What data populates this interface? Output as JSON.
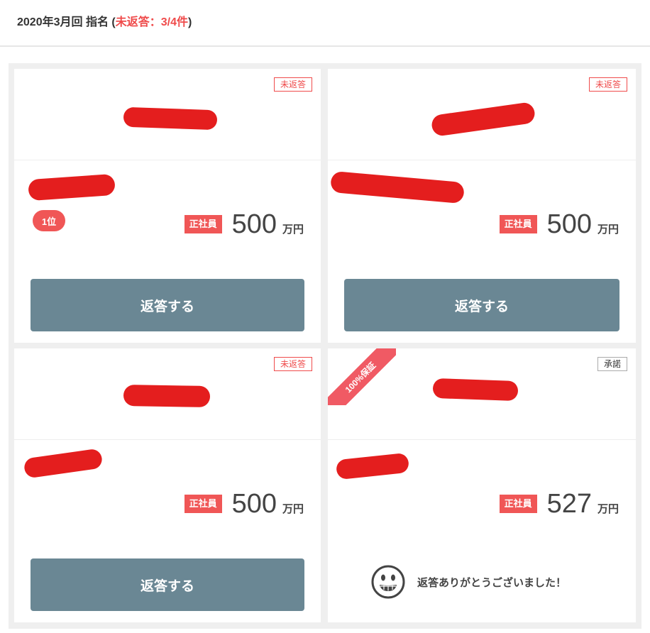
{
  "header": {
    "title": "2020年3月回 指名",
    "open_paren": " (",
    "status": "未返答：3/4件",
    "close_paren": ")"
  },
  "cards": [
    {
      "badge": "未返答",
      "rank": "1位",
      "employment_type": "正社員",
      "amount": "500",
      "unit": "万円",
      "reply_button": "返答する"
    },
    {
      "badge": "未返答",
      "employment_type": "正社員",
      "amount": "500",
      "unit": "万円",
      "reply_button": "返答する"
    },
    {
      "badge": "未返答",
      "employment_type": "正社員",
      "amount": "500",
      "unit": "万円",
      "reply_button": "返答する"
    },
    {
      "ribbon": "100%保証",
      "badge": "承諾",
      "employment_type": "正社員",
      "amount": "527",
      "unit": "万円",
      "thanks_message": "返答ありがとうございました！",
      "thanks_icon": "smiley-face-icon"
    }
  ],
  "colors": {
    "accent_red": "#ef4b4b",
    "button_slate": "#6a8794",
    "redaction": "#e41e1e"
  }
}
